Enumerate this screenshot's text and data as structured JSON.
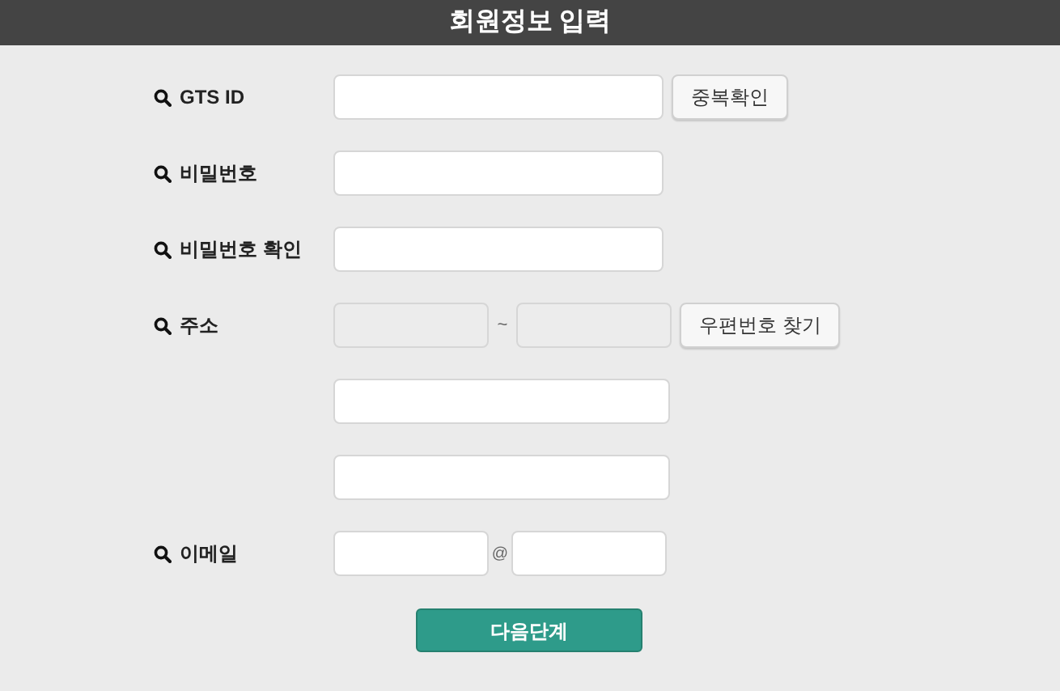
{
  "title": "회원정보 입력",
  "rows": [
    {
      "kind": "text_button",
      "label": "GTS ID",
      "button": "중복확인"
    },
    {
      "kind": "text",
      "label": "비밀번호"
    },
    {
      "kind": "text",
      "label": "비밀번호 확인"
    },
    {
      "kind": "zip",
      "label": "주소",
      "separator": "~",
      "button": "우편번호 찾기",
      "disabled": true
    },
    {
      "kind": "wide"
    },
    {
      "kind": "wide"
    },
    {
      "kind": "email",
      "label": "이메일",
      "separator": "@"
    }
  ],
  "submit": "다음단계"
}
